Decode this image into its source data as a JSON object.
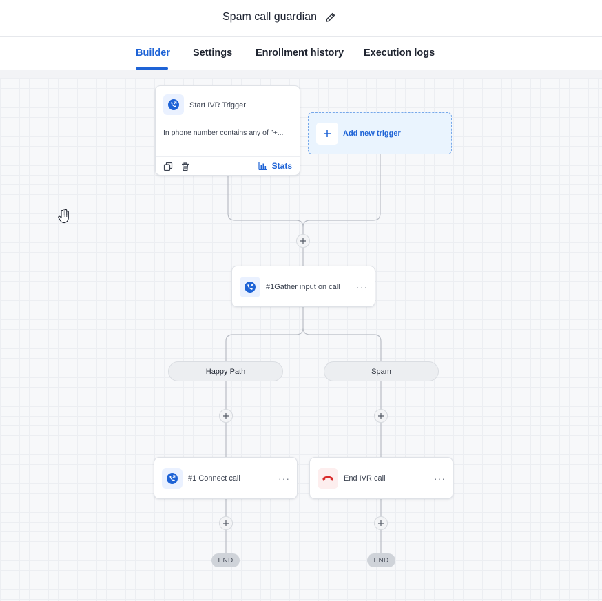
{
  "header": {
    "title": "Spam call guardian",
    "edit_icon": "pencil-icon"
  },
  "tabs": [
    {
      "label": "Builder",
      "active": true
    },
    {
      "label": "Settings",
      "active": false
    },
    {
      "label": "Enrollment history",
      "active": false
    },
    {
      "label": "Execution logs",
      "active": false
    }
  ],
  "trigger": {
    "title": "Start IVR Trigger",
    "description": "In phone number contains any of \"+...",
    "icon": "phone-incoming-icon",
    "stats_label": "Stats"
  },
  "add_trigger": {
    "label": "Add new trigger"
  },
  "steps": [
    {
      "label": "#1Gather input on call",
      "icon": "phone-incoming-icon"
    },
    {
      "label": "#1 Connect call",
      "icon": "phone-incoming-icon"
    },
    {
      "label": "End IVR call",
      "icon": "phone-hangup-icon"
    }
  ],
  "branches": [
    {
      "label": "Happy Path"
    },
    {
      "label": "Spam"
    }
  ],
  "end_label": "END",
  "colors": {
    "accent": "#1e63d6",
    "hangup_red": "#d92b2b",
    "canvas_bg": "#f7f8fa"
  }
}
